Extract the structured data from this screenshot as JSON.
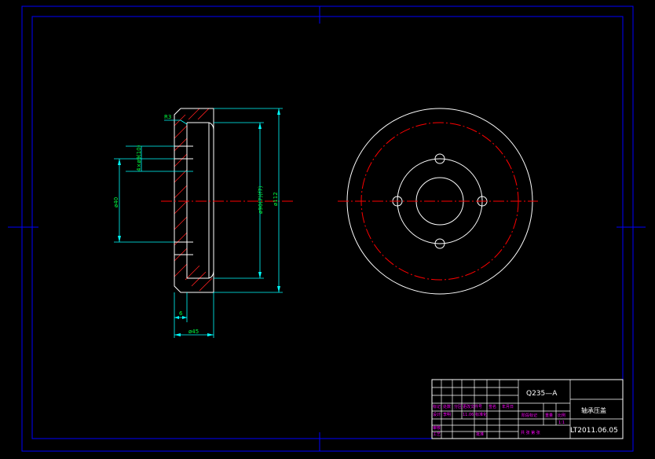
{
  "colors": {
    "background": "#000000",
    "frame": "#0000ff",
    "outline": "#ffffff",
    "dimension": "#00ffff",
    "dimension_text": "#00ff40",
    "centerline": "#ff0000",
    "hatch": "#ff2020",
    "titleblock_text": "#ff00ff"
  },
  "section_view": {
    "dim_r3": "R3",
    "dim_holes": "4×ø9(10)",
    "dim_d40": "ø40",
    "dim_d90": "ø90(7)(f7)",
    "dim_d112": "ø112",
    "dim_thickness_6": "6",
    "dim_length_45": "ø45"
  },
  "title_block": {
    "material": "Q235—A",
    "part_name": "轴承压盖",
    "drawing_number": "LT2011.06.05",
    "labels": {
      "mark": "标记",
      "count": "处数",
      "zone": "分区",
      "change_doc": "更改文件号",
      "signature": "签名",
      "date": "年月日",
      "designer": "设计",
      "standardization": "标准化",
      "stage_mark": "阶段标记",
      "weight": "重量",
      "scale": "比例",
      "reviewer": "审核",
      "process": "工艺",
      "approve": "批准",
      "sheets": "共 张 第 张",
      "scale_value": "1:1",
      "date_value": "11.06",
      "author": "李明"
    }
  }
}
